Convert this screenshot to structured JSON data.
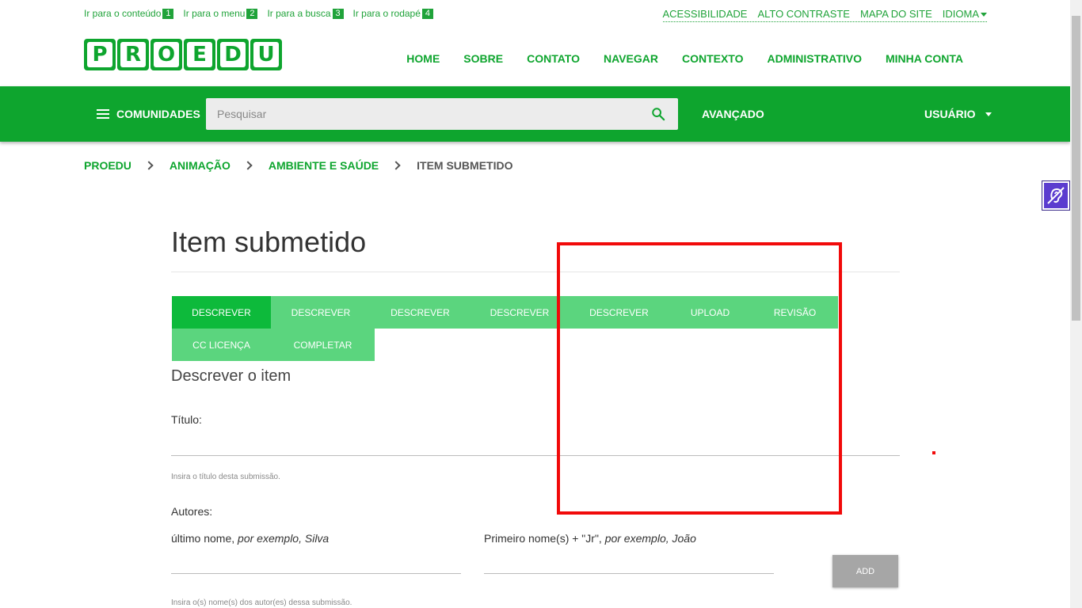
{
  "skip_links": [
    {
      "label": "Ir para o conteúdo",
      "num": "1"
    },
    {
      "label": "Ir para o menu",
      "num": "2"
    },
    {
      "label": "Ir para a busca",
      "num": "3"
    },
    {
      "label": "Ir para o rodapé",
      "num": "4"
    }
  ],
  "utility_nav": {
    "accessibility": "ACESSIBILIDADE",
    "contrast": "ALTO CONTRASTE",
    "sitemap": "MAPA DO SITE",
    "language": "IDIOMA"
  },
  "logo": {
    "letters": [
      "P",
      "R",
      "O",
      "E",
      "D",
      "U"
    ]
  },
  "main_nav": [
    "HOME",
    "SOBRE",
    "CONTATO",
    "NAVEGAR",
    "CONTEXTO",
    "ADMINISTRATIVO",
    "MINHA CONTA"
  ],
  "toolbar": {
    "communities_label": "COMUNIDADES",
    "search_placeholder": "Pesquisar",
    "advanced_label": "AVANÇADO",
    "user_label": "USUÁRIO"
  },
  "breadcrumb": [
    {
      "label": "PROEDU"
    },
    {
      "label": "ANIMAÇÃO"
    },
    {
      "label": "AMBIENTE E SAÚDE"
    },
    {
      "label": "ITEM SUBMETIDO"
    }
  ],
  "page": {
    "title": "Item submetido",
    "subheading": "Descrever o item"
  },
  "tabs": {
    "row1": [
      {
        "label": "DESCREVER",
        "active": true
      },
      {
        "label": "DESCREVER"
      },
      {
        "label": "DESCREVER"
      },
      {
        "label": "DESCREVER"
      },
      {
        "label": "DESCREVER"
      },
      {
        "label": "UPLOAD"
      },
      {
        "label": "REVISÃO"
      }
    ],
    "row2": [
      {
        "label": "CC LICENÇA"
      },
      {
        "label": "COMPLETAR"
      }
    ]
  },
  "form": {
    "title_label": "Título:",
    "title_help": "Insira o título desta submissão.",
    "authors_label": "Autores:",
    "last_name_label": "último nome, ",
    "last_name_example": "por exemplo, Silva",
    "first_name_label": "Primeiro nome(s) + \"Jr\", ",
    "first_name_example": "por exemplo, João",
    "add_button": "ADD",
    "authors_help": "Insira o(s) nome(s) dos autor(es) dessa submissão."
  },
  "colors": {
    "brand_green": "#0ea52e",
    "tab_green": "#5bd57e",
    "tab_active": "#0dba3b",
    "annotation_red": "#f10a0a"
  }
}
